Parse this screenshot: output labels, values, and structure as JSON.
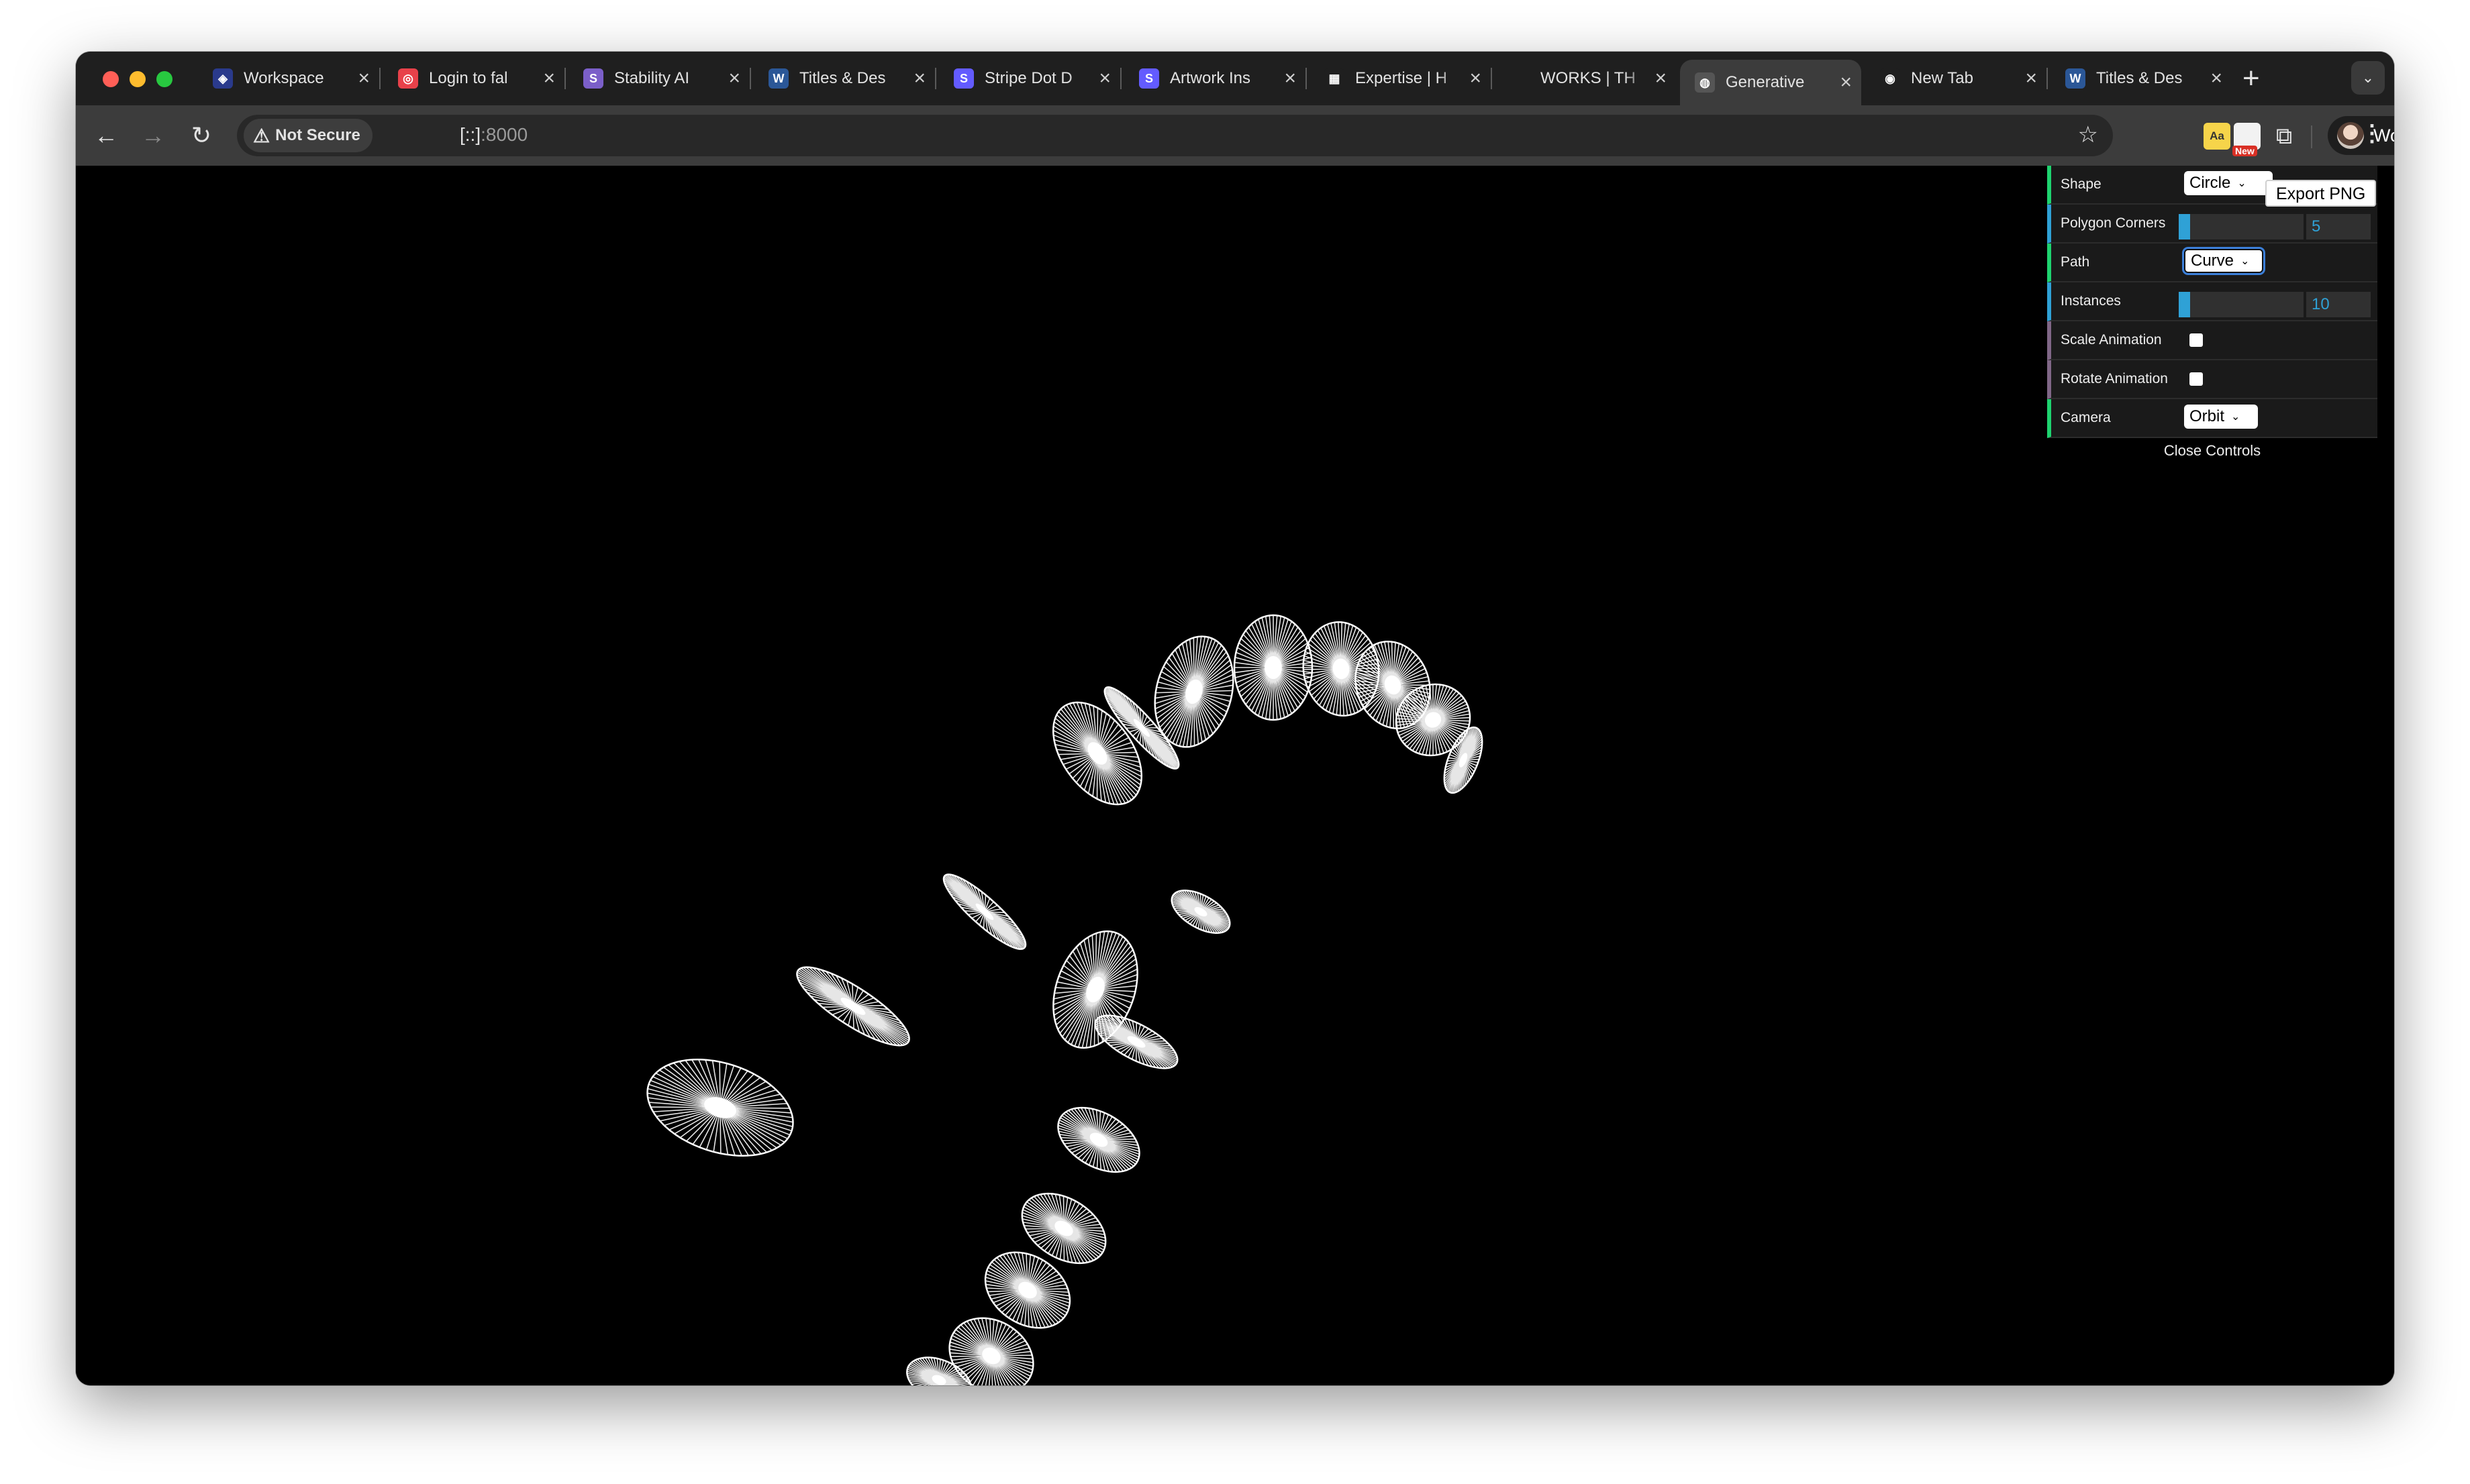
{
  "browser": {
    "tabs": [
      {
        "label": "Workspace",
        "icon": "workspace-icon",
        "color": "#2a3a8c"
      },
      {
        "label": "Login to fal",
        "icon": "fal-logo-icon",
        "color": "#e8414a"
      },
      {
        "label": "Stability AI",
        "icon": "stability-logo-icon",
        "color": "#7b5fc9"
      },
      {
        "label": "Titles & Des",
        "icon": "word-doc-icon",
        "color": "#2b5797"
      },
      {
        "label": "Stripe Dot D",
        "icon": "stripe-logo-icon",
        "color": "#635bff"
      },
      {
        "label": "Artwork Ins",
        "icon": "stripe-logo-icon",
        "color": "#635bff"
      },
      {
        "label": "Expertise | H",
        "icon": "grid-squares-icon",
        "color": "#1f1f1f"
      },
      {
        "label": "WORKS | TH",
        "icon": "",
        "color": "#1f1f1f"
      },
      {
        "label": "Generative",
        "icon": "globe-icon",
        "color": "#555555",
        "active": true
      },
      {
        "label": "New Tab",
        "icon": "chrome-logo-icon",
        "color": "#1f1f1f"
      },
      {
        "label": "Titles & Des",
        "icon": "word-doc-icon",
        "color": "#2b5797"
      }
    ],
    "new_tab_symbol": "+",
    "tab_search_symbol": "⌄",
    "close_symbol": "×"
  },
  "toolbar": {
    "back": "←",
    "forward": "→",
    "reload": "↻",
    "security_warning": "⚠",
    "security_label": "Not Secure",
    "url_host": "[::]",
    "url_port": ":8000",
    "bookmark": "☆",
    "ext_dictionary": "Aa",
    "ext_new_badge": "New",
    "ext_puzzle": "⧉",
    "profile_name": "Work",
    "menu": "⋮"
  },
  "controls": {
    "shape": {
      "label": "Shape",
      "value": "Circle"
    },
    "export_label": "Export PNG",
    "polygon_corners": {
      "label": "Polygon Corners",
      "value": "5",
      "fraction": 0.09
    },
    "path": {
      "label": "Path",
      "value": "Curve"
    },
    "instances": {
      "label": "Instances",
      "value": "10",
      "fraction": 0.09
    },
    "scale_animation": {
      "label": "Scale Animation",
      "checked": false
    },
    "rotate_animation": {
      "label": "Rotate Animation",
      "checked": false
    },
    "camera": {
      "label": "Camera",
      "value": "Orbit"
    },
    "close_label": "Close Controls"
  },
  "colors": {
    "canvas_background": "#000000",
    "shape_stroke": "#ffffff",
    "list_accent": "#1ed36f",
    "number_accent": "#2fa1d6",
    "bool_accent": "#806787"
  }
}
